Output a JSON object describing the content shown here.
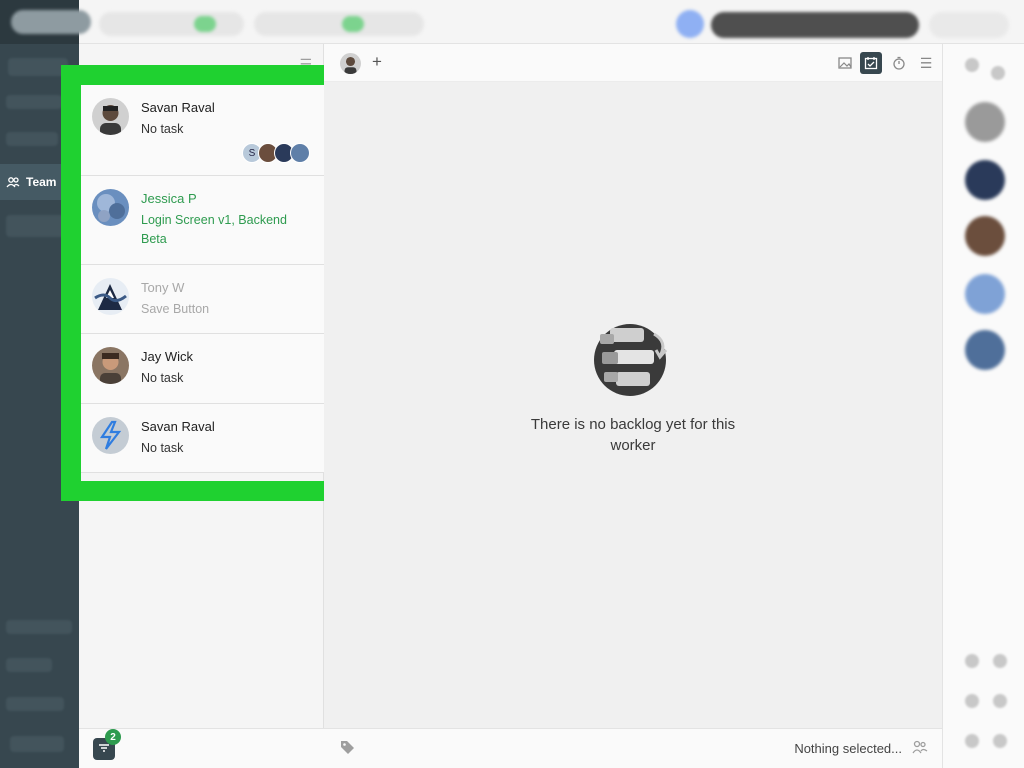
{
  "sidebar": {
    "active_item": "Team",
    "colors": {
      "bg": "#37474f",
      "active_bg": "#455a64"
    }
  },
  "team_list": {
    "members": [
      {
        "name": "Savan Raval",
        "task": "No task",
        "style": "dark"
      },
      {
        "name": "Jessica P",
        "task": "Login Screen v1, Backend Beta",
        "style": "green"
      },
      {
        "name": "Tony W",
        "task": "Save Button",
        "style": "grey"
      },
      {
        "name": "Jay Wick",
        "task": "No task",
        "style": "dark"
      },
      {
        "name": "Savan Raval",
        "task": "No task",
        "style": "dark"
      }
    ],
    "filter_badge_count": "2",
    "mini_avatar_letter": "S"
  },
  "main": {
    "empty_message": "There is no backlog yet for this worker",
    "add_label": "+",
    "selection_status": "Nothing selected..."
  },
  "colors": {
    "highlight": "#1fd130",
    "accent_green": "#2e9b4f",
    "muted": "#a8a8a8"
  }
}
